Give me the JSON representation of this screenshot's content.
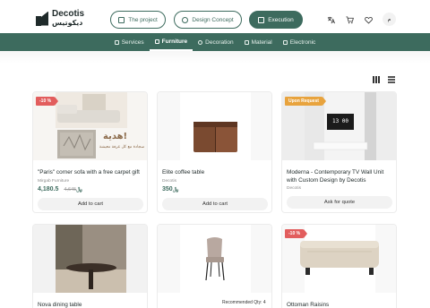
{
  "brand": {
    "name_en": "Decotis",
    "name_ar": "ديكوتيس"
  },
  "header": {
    "pills": [
      {
        "label": "The project",
        "icon": "home-icon"
      },
      {
        "label": "Design Concept",
        "icon": "palette-icon"
      },
      {
        "label": "Execution",
        "icon": "briefcase-icon"
      }
    ],
    "avatar_label": "م"
  },
  "nav": {
    "items": [
      {
        "label": "Services"
      },
      {
        "label": "Furniture"
      },
      {
        "label": "Decoration"
      },
      {
        "label": "Material"
      },
      {
        "label": "Electronic"
      }
    ]
  },
  "colors": {
    "primary": "#3d6b5e",
    "sale": "#e25d5d",
    "order": "#e8a33d"
  },
  "currency_symbol": "﷼",
  "products": [
    {
      "title": "\"Paris\" corner sofa with a free carpet gift",
      "vendor": "Mirgab Furniture",
      "price": "4,180.5",
      "old_price": "4,645",
      "badge": "-10 %",
      "button": "Add to cart",
      "promo_ar": "هدية!",
      "promo_ar_sub": "سجادة مع كل غرفة معيشة"
    },
    {
      "title": "Elite coffee table",
      "vendor": "Decotis",
      "price": "350",
      "button": "Add to cart"
    },
    {
      "title": "Moderna - Contemporary TV Wall Unit with Custom Design by Decotis",
      "vendor": "Decotis",
      "badge": "Upon Request",
      "button": "Ask for quote",
      "tv_time": "13 00"
    },
    {
      "title": "Nova dining table"
    },
    {
      "title": "",
      "recommended": "Recommended Qty: 4"
    },
    {
      "title": "Ottoman Raisins",
      "badge": "-10 %"
    }
  ]
}
